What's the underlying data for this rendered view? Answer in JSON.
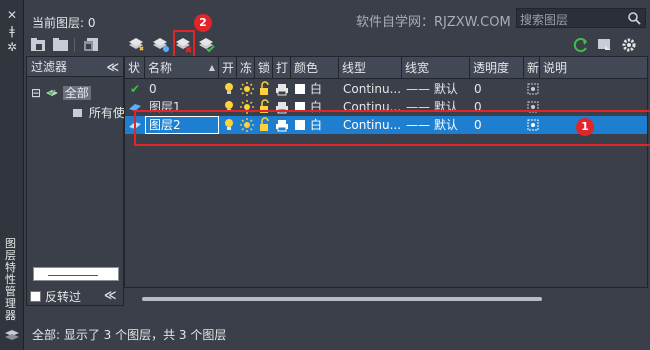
{
  "palette": {
    "accent": "#1e7fd1",
    "annotation": "#e0262b",
    "bg": "#3a3f4a",
    "header": "#424856"
  },
  "side": {
    "vertical_title": "图层特性管理器",
    "icons": [
      "close-icon",
      "pin-icon",
      "settings-icon"
    ]
  },
  "header": {
    "current_layer": "当前图层: 0",
    "brand": "软件自学网：RJZXW.COM",
    "search_placeholder": "搜索图层"
  },
  "toolbar_icons": [
    "new-property-filter",
    "new-group-filter",
    "layer-states-manager",
    "new-layer",
    "new-layer-vp-frozen",
    "delete-layer",
    "set-current",
    "refresh",
    "settings"
  ],
  "filters": {
    "title": "过滤器",
    "collapse": "≪",
    "tree": [
      {
        "label": "全部",
        "expander": "⊟",
        "selected": true
      },
      {
        "label": "所有使",
        "expander": "",
        "selected": false
      }
    ],
    "invert_label": "反转过"
  },
  "grid": {
    "columns": [
      "状",
      "名称",
      "开",
      "冻",
      "锁",
      "打",
      "颜色",
      "线型",
      "线宽",
      "透明度",
      "新",
      "说明"
    ],
    "rows": [
      {
        "status": "✔",
        "name": "0",
        "color": "白",
        "linetype": "Continu...",
        "lineweight": "—— 默认",
        "transparency": "0",
        "selected": false
      },
      {
        "status": "layer",
        "name": "图层1",
        "color": "白",
        "linetype": "Continu...",
        "lineweight": "—— 默认",
        "transparency": "0",
        "selected": false
      },
      {
        "status": "layer",
        "name": "图层2",
        "color": "白",
        "linetype": "Continu...",
        "lineweight": "—— 默认",
        "transparency": "0",
        "selected": true
      }
    ]
  },
  "annotations": {
    "badge1": "1",
    "badge2": "2"
  },
  "status_bar": "全部: 显示了 3 个图层，共 3 个图层"
}
